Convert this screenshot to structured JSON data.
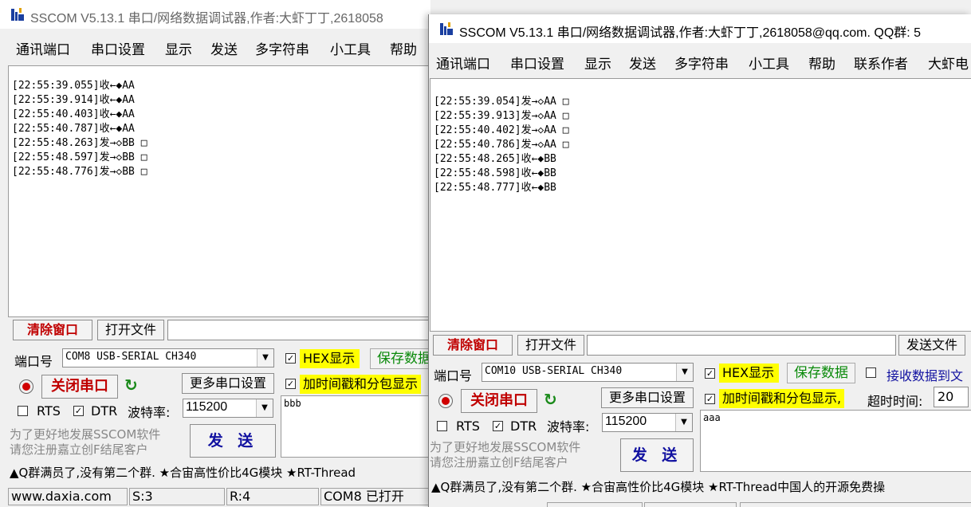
{
  "colors": {
    "accent_red": "#c00000",
    "highlight": "#ffff00",
    "save_green": "#0a8a0a"
  },
  "w1": {
    "title": "SSCOM V5.13.1 串口/网络数据调试器,作者:大虾丁丁,2618058",
    "menu": [
      "通讯端口",
      "串口设置",
      "显示",
      "发送",
      "多字符串",
      "小工具",
      "帮助"
    ],
    "recv_lines": [
      "[22:55:39.055]收←◆AA",
      "[22:55:39.914]收←◆AA",
      "[22:55:40.403]收←◆AA",
      "[22:55:40.787]收←◆AA",
      "[22:55:48.263]发→◇BB □",
      "[22:55:48.597]发→◇BB □",
      "[22:55:48.776]发→◇BB □"
    ],
    "clear_btn": "清除窗口",
    "open_file_btn": "打开文件",
    "port_label": "端口号",
    "port_value": "COM8 USB-SERIAL CH340",
    "hex_display": "HEX显示",
    "save_data": "保存数据",
    "close_port": "关闭串口",
    "more_settings": "更多串口设置",
    "timestamp_label": "加时间戳和分包显示",
    "rts": "RTS",
    "dtr": "DTR",
    "baud_label": "波特率:",
    "baud_value": "115200",
    "send_text": "bbb",
    "ad_line1": "为了更好地发展SSCOM软件",
    "ad_line2": "请您注册嘉立创F结尾客户",
    "send_btn": "发 送",
    "ticker": "▲Q群满员了,没有第二个群. ★合宙高性价比4G模块 ★RT-Thread",
    "status": {
      "site": "www.daxia.com",
      "sent": "S:3",
      "recv": "R:4",
      "port": "COM8 已打开"
    }
  },
  "w2": {
    "title": "SSCOM V5.13.1 串口/网络数据调试器,作者:大虾丁丁,2618058@qq.com. QQ群: 5",
    "menu": [
      "通讯端口",
      "串口设置",
      "显示",
      "发送",
      "多字符串",
      "小工具",
      "帮助",
      "联系作者",
      "大虾电"
    ],
    "recv_lines": [
      "[22:55:39.054]发→◇AA □",
      "[22:55:39.913]发→◇AA □",
      "[22:55:40.402]发→◇AA □",
      "[22:55:40.786]发→◇AA □",
      "[22:55:48.265]收←◆BB",
      "[22:55:48.598]收←◆BB",
      "[22:55:48.777]收←◆BB"
    ],
    "clear_btn": "清除窗口",
    "open_file_btn": "打开文件",
    "send_file_btn": "发送文件",
    "port_label": "端口号",
    "port_value": "COM10 USB-SERIAL CH340",
    "hex_display": "HEX显示",
    "save_data": "保存数据",
    "recv_to_file": "接收数据到文",
    "close_port": "关闭串口",
    "more_settings": "更多串口设置",
    "timestamp_label": "加时间戳和分包显示,",
    "timeout_label": "超时时间:",
    "timeout_value": "20",
    "rts": "RTS",
    "dtr": "DTR",
    "baud_label": "波特率:",
    "baud_value": "115200",
    "send_text": "aaa",
    "ad_line1": "为了更好地发展SSCOM软件",
    "ad_line2": "请您注册嘉立创F结尾客户",
    "send_btn": "发 送",
    "ticker": "▲Q群满员了,没有第二个群. ★合宙高性价比4G模块 ★RT-Thread中国人的开源免费操"
  }
}
